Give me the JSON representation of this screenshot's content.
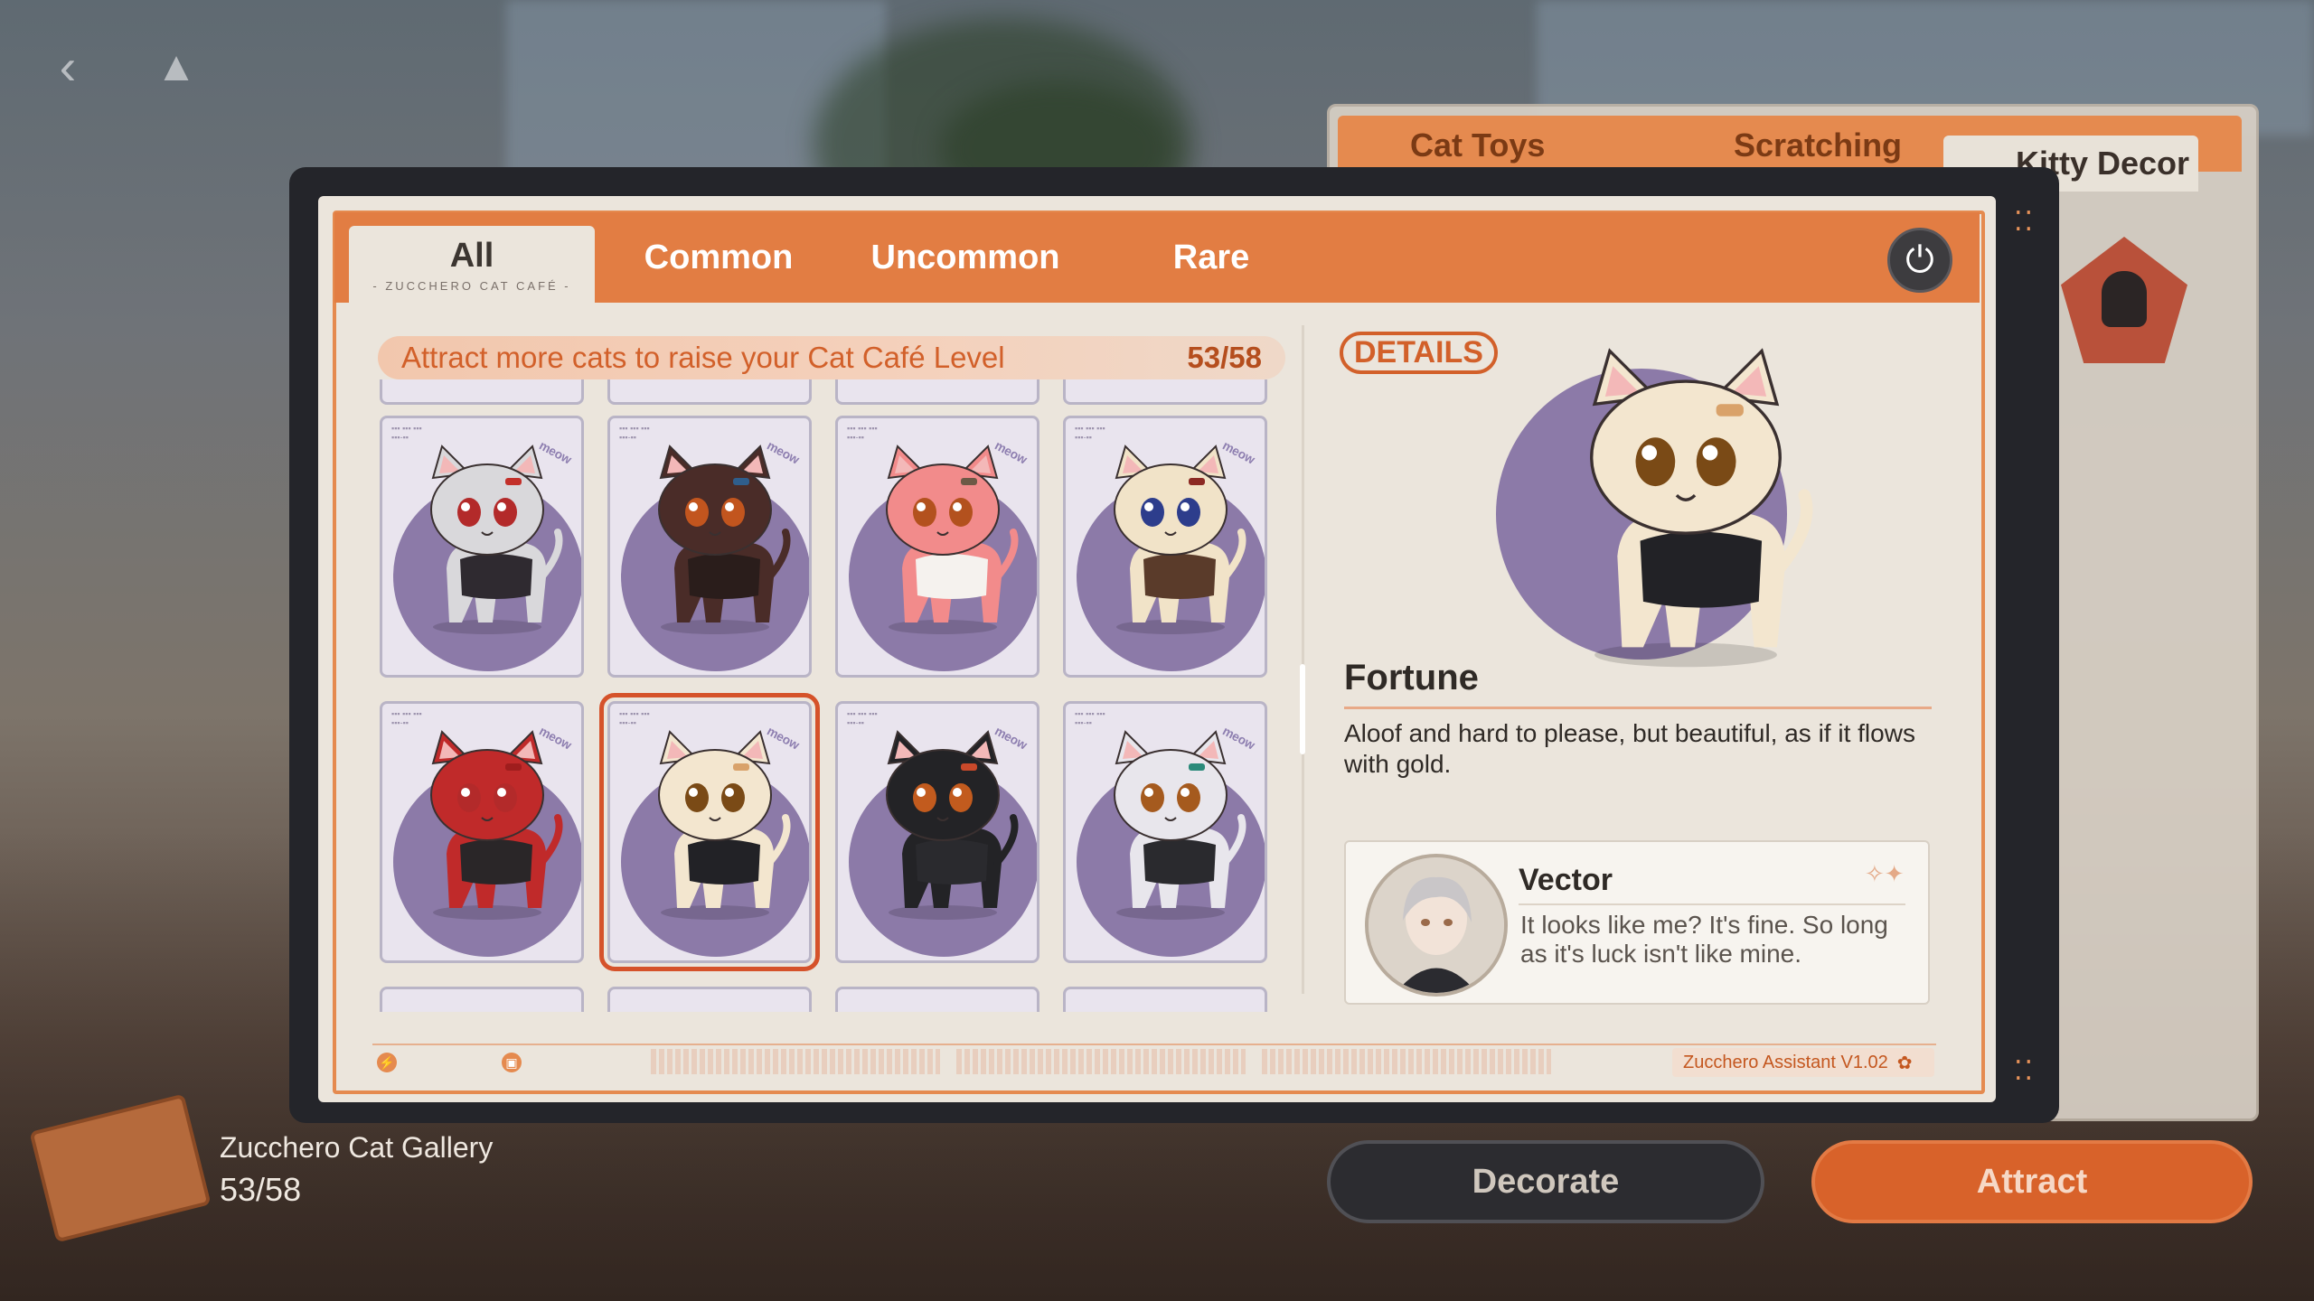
{
  "window": {
    "back_icon": "back-arrow-icon",
    "drive_icon": "drive-icon"
  },
  "background_panel": {
    "tabs": [
      {
        "label": "Cat Toys"
      },
      {
        "label": "Scratching"
      },
      {
        "label": "Kitty Decor"
      }
    ],
    "active_tab": "Kitty Decor"
  },
  "tabs": [
    {
      "label": "All",
      "sub": "- ZUCCHERO CAT CAFÉ -"
    },
    {
      "label": "Common"
    },
    {
      "label": "Uncommon"
    },
    {
      "label": "Rare"
    }
  ],
  "power_icon": "power-icon",
  "progress": {
    "text": "Attract more cats to raise your Cat Café Level",
    "count": "53/58"
  },
  "grid": {
    "cards": [
      {
        "name": "grey-red-cat",
        "fur": "#d9d8db",
        "accent": "#c3302a",
        "eyes": "#b32a2a",
        "outfit": "#2f2a30"
      },
      {
        "name": "brown-ribbon-cat",
        "fur": "#4a2c28",
        "accent": "#2f5e8c",
        "eyes": "#c2551e",
        "outfit": "#2a1d1b"
      },
      {
        "name": "pink-beret-cat",
        "fur": "#f28b8b",
        "accent": "#6d5946",
        "eyes": "#b3511e",
        "outfit": "#f5f2ee"
      },
      {
        "name": "cream-scarf-cat",
        "fur": "#f1e3c8",
        "accent": "#8c2a24",
        "eyes": "#2d3d8c",
        "outfit": "#5a3b2a"
      },
      {
        "name": "red-hood-cat",
        "fur": "#c02a2a",
        "accent": "#9f1d1d",
        "eyes": "#b32a2a",
        "outfit": "#2a2628"
      },
      {
        "name": "fortune-cat",
        "fur": "#f3e6cf",
        "accent": "#d9a26a",
        "eyes": "#7a4a16",
        "outfit": "#222226"
      },
      {
        "name": "black-cat",
        "fur": "#232326",
        "accent": "#c9492a",
        "eyes": "#c25b1e",
        "outfit": "#2a2a2e"
      },
      {
        "name": "white-cat",
        "fur": "#e8e6ec",
        "accent": "#2a8a7a",
        "eyes": "#a55a1e",
        "outfit": "#2a2a2e"
      }
    ],
    "selected_index": 5
  },
  "details": {
    "logo": "DETAILS",
    "name": "Fortune",
    "description": "Aloof and hard to please, but beautiful, as if it flows with gold.",
    "quote": {
      "speaker": "Vector",
      "text": "It looks like me? It's fine. So long as it's luck isn't like mine."
    }
  },
  "footer": {
    "assistant": "Zucchero Assistant V1.02"
  },
  "gallery": {
    "title": "Zucchero Cat Gallery",
    "count": "53/58"
  },
  "actions": {
    "decorate": "Decorate",
    "attract": "Attract"
  },
  "colors": {
    "accent": "#e27d43",
    "panel": "#ebe5dc",
    "card_disc": "#8c7aa8"
  }
}
